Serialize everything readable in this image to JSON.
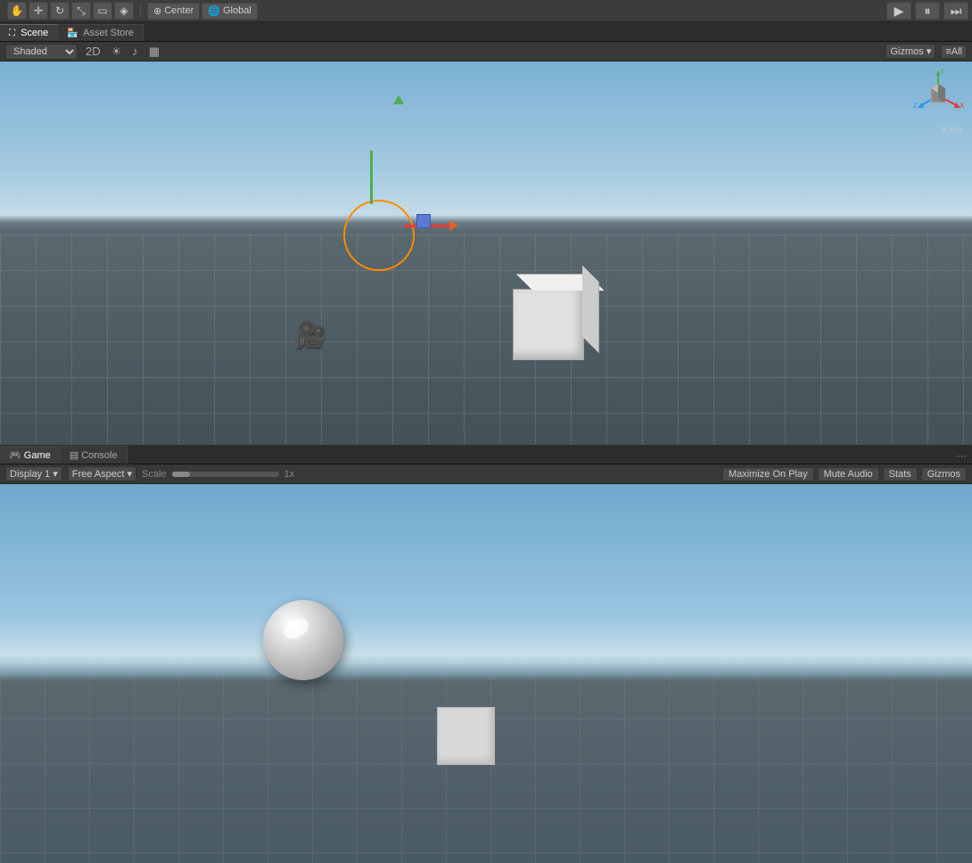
{
  "toolbar": {
    "tools": [
      "hand",
      "move",
      "rotate",
      "scale",
      "rect",
      "custom"
    ],
    "center_label": "Center",
    "global_label": "Global",
    "play_btn": "▶",
    "pause_btn": "⏸",
    "step_btn": "⏭"
  },
  "scene_tab": {
    "label": "Scene",
    "asset_store_label": "Asset Store"
  },
  "scene_toolbar": {
    "shading": "Shaded",
    "mode_2d": "2D",
    "gizmos_label": "Gizmos",
    "all_label": "All"
  },
  "gizmo": {
    "iso_label": "Iso"
  },
  "bottom_panel": {
    "game_tab": "Game",
    "console_tab": "Console"
  },
  "game_toolbar": {
    "display_label": "Display 1",
    "aspect_label": "Free Aspect",
    "scale_label": "Scale",
    "scale_value": "1x",
    "maximize_label": "Maximize On Play",
    "mute_label": "Mute Audio",
    "stats_label": "Stats",
    "gizmos_label": "Gizmos"
  }
}
